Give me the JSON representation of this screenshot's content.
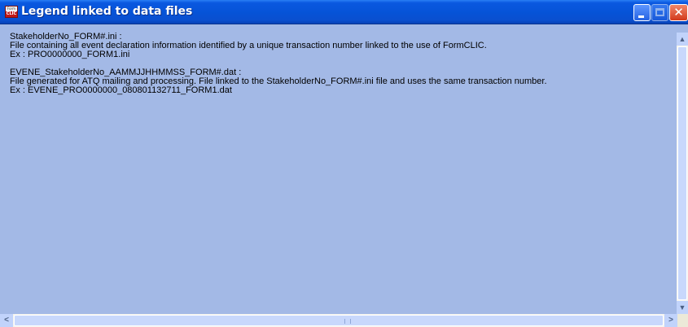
{
  "window": {
    "title": "Legend linked to data files",
    "icon_top": "Form",
    "icon_bottom": "CLIC",
    "accent": "#0a58e0",
    "background": "#a3b9e6"
  },
  "content": {
    "block1": {
      "heading": "StakeholderNo_FORM#.ini :",
      "description": "File containing all event declaration information identified by a unique transaction number linked to the use of FormCLIC.",
      "example": "Ex : PRO0000000_FORM1.ini"
    },
    "block2": {
      "heading": "EVENE_StakeholderNo_AAMMJJHHMMSS_FORM#.dat :",
      "description": "File generated for ATQ mailing and processing. File linked to the StakeholderNo_FORM#.ini file and uses the same transaction number.",
      "example": "Ex : EVENE_PRO0000000_080801132711_FORM1.dat"
    }
  },
  "titlebar_buttons": {
    "minimize_icon": "minimize-icon",
    "maximize_icon": "maximize-icon",
    "close_icon": "close-icon",
    "close_glyph": "✕"
  },
  "scrollbars": {
    "up_glyph": "▲",
    "down_glyph": "▼",
    "left_glyph": "<",
    "right_glyph": ">"
  }
}
